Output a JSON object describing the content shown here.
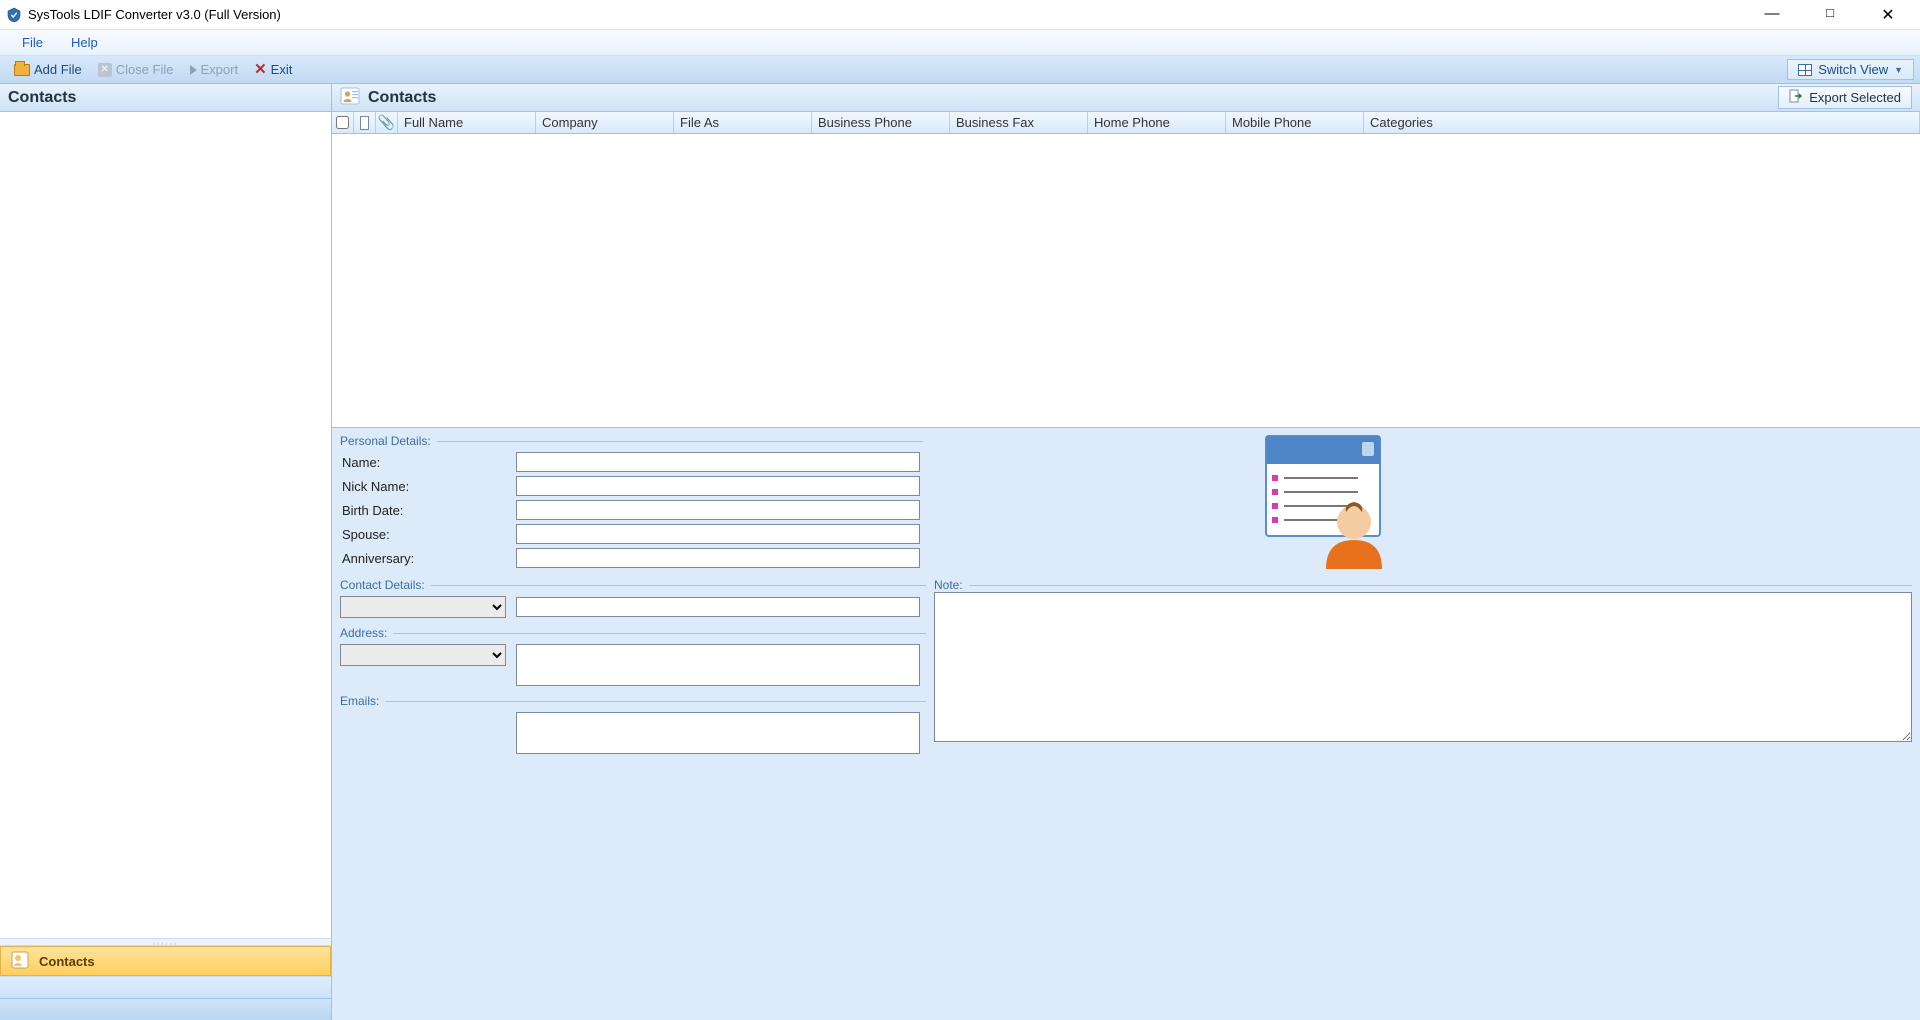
{
  "window": {
    "title": "SysTools LDIF Converter v3.0 (Full Version)"
  },
  "menu": {
    "file": "File",
    "help": "Help"
  },
  "toolbar": {
    "add_file": "Add File",
    "close_file": "Close File",
    "export": "Export",
    "exit": "Exit",
    "switch_view": "Switch View"
  },
  "left_panel": {
    "header": "Contacts",
    "nav_contacts": "Contacts"
  },
  "right_panel": {
    "header": "Contacts",
    "export_selected": "Export Selected",
    "columns": {
      "full_name": "Full Name",
      "company": "Company",
      "file_as": "File As",
      "business_phone": "Business Phone",
      "business_fax": "Business Fax",
      "home_phone": "Home Phone",
      "mobile_phone": "Mobile Phone",
      "categories": "Categories"
    }
  },
  "details": {
    "group_personal": "Personal Details:",
    "name": "Name:",
    "nick_name": "Nick Name:",
    "birth_date": "Birth Date:",
    "spouse": "Spouse:",
    "anniversary": "Anniversary:",
    "group_contact": "Contact Details:",
    "group_note": "Note:",
    "group_address": "Address:",
    "group_emails": "Emails:",
    "values": {
      "name": "",
      "nick_name": "",
      "birth_date": "",
      "spouse": "",
      "anniversary": "",
      "contact_type": "",
      "contact_value": "",
      "address_type": "",
      "address_value": "",
      "email_value": "",
      "note": ""
    }
  }
}
